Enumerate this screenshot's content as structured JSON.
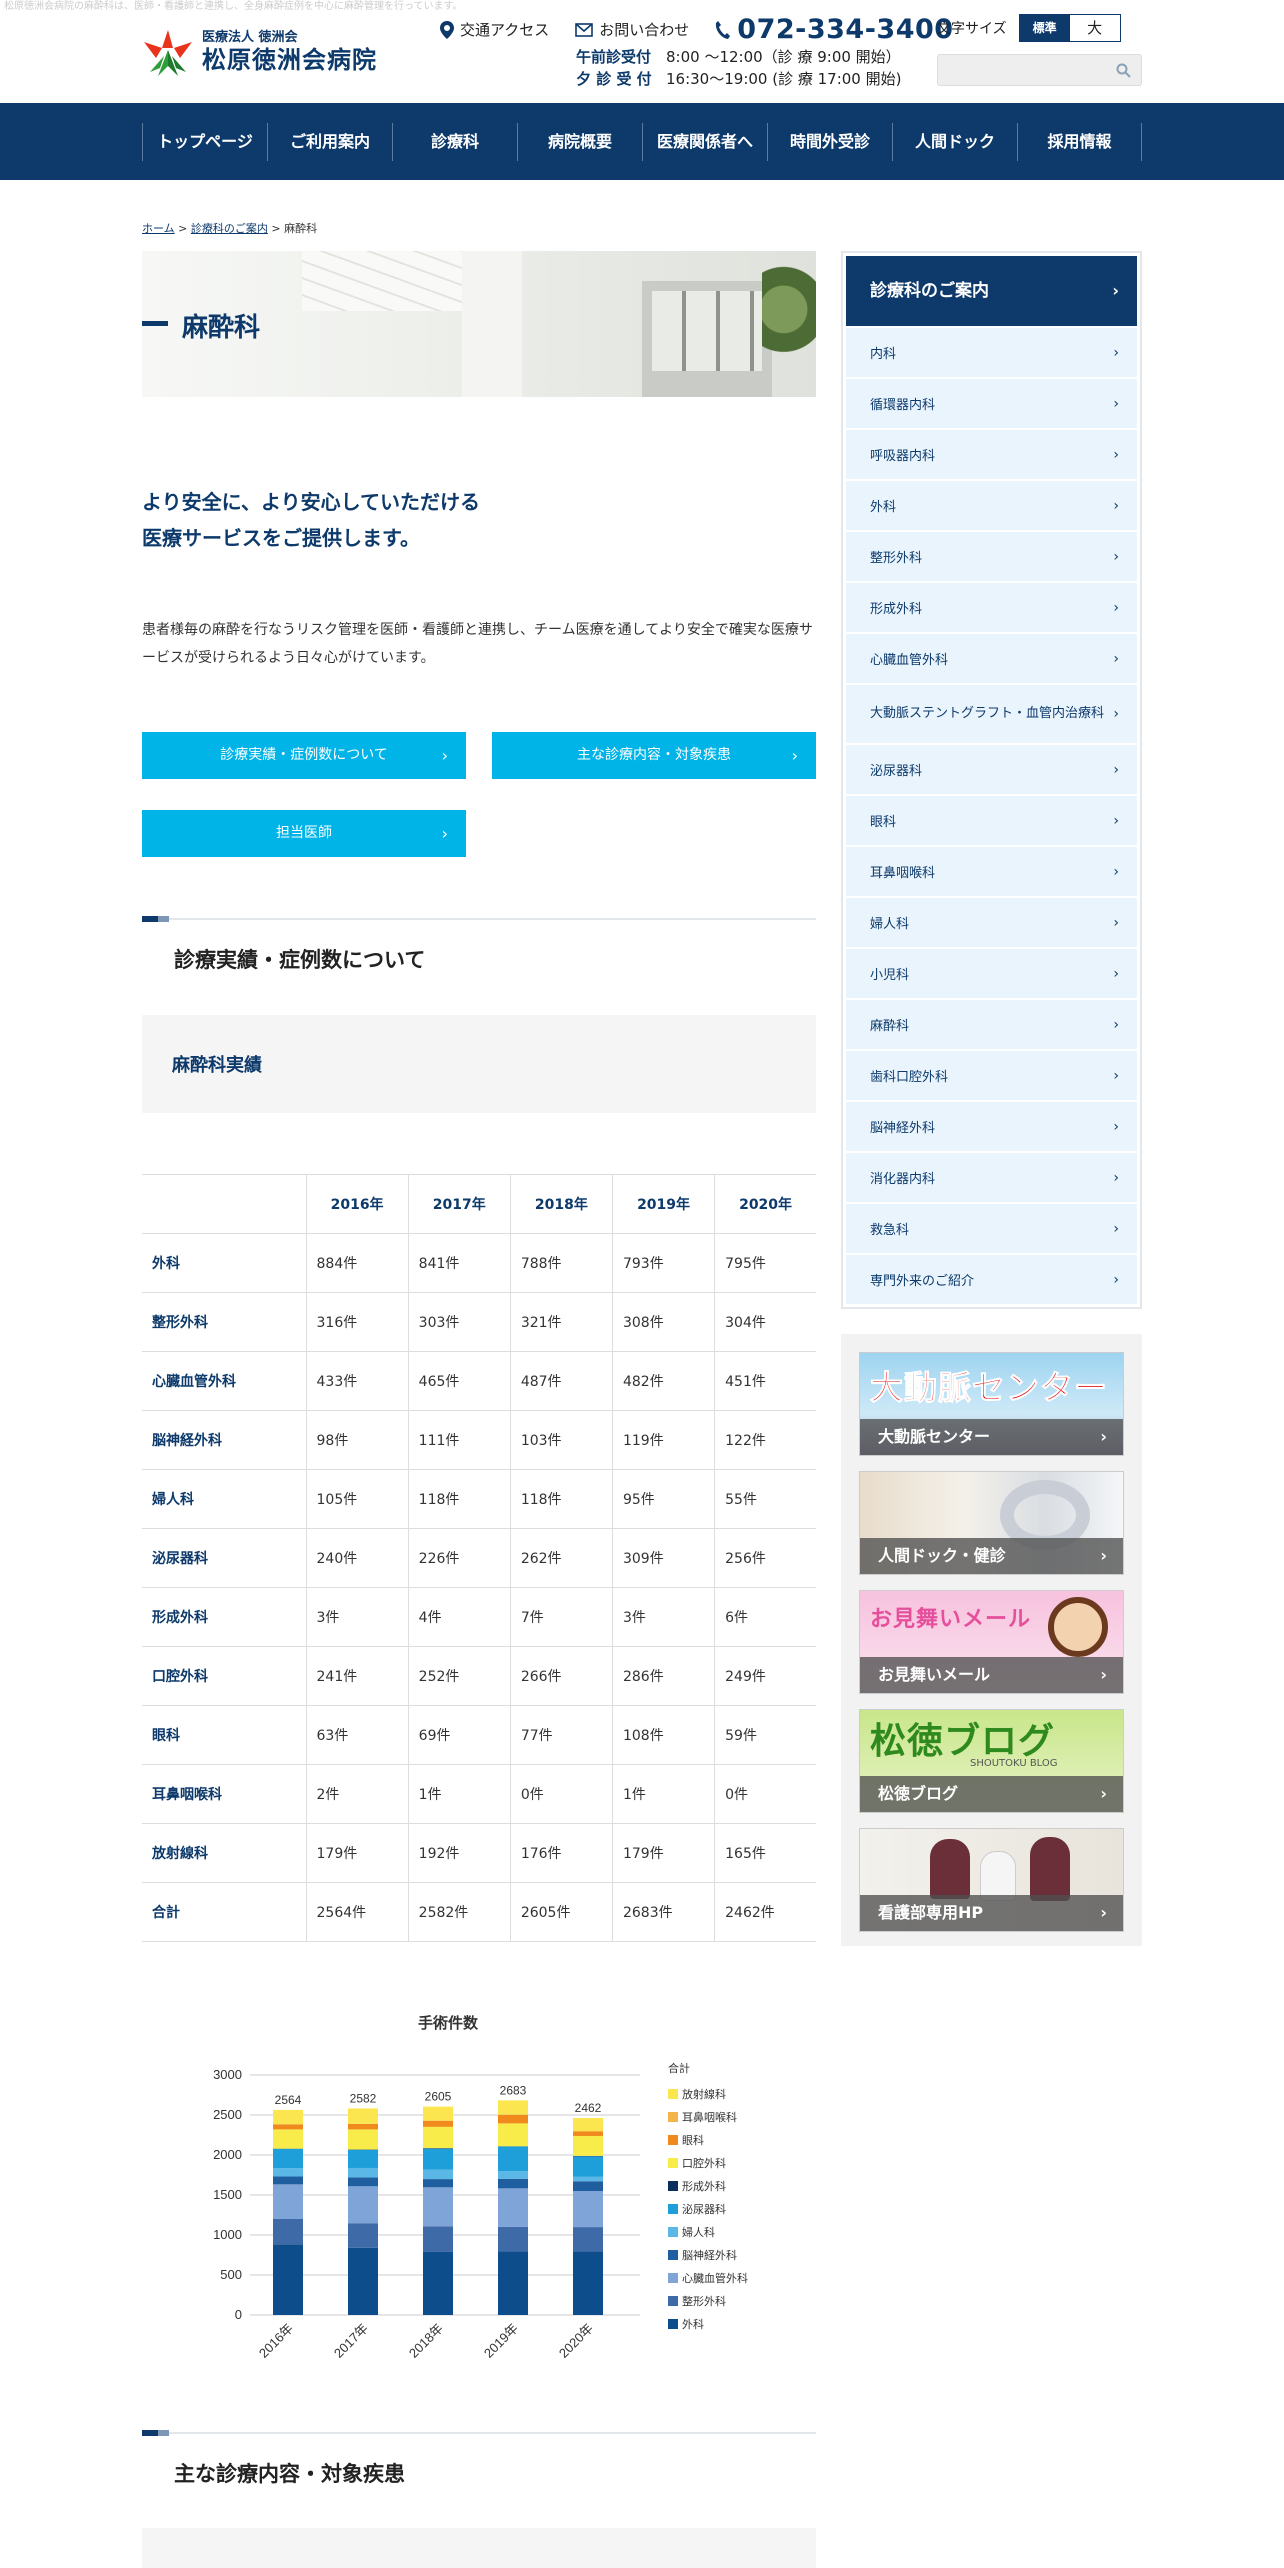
{
  "top_note": "松原徳洲会病院の麻酔科は、医師・看護師と連携し、全身麻酔症例を中心に麻酔管理を行っています。",
  "header": {
    "logo_sub": "医療法人 徳洲会",
    "logo_main": "松原徳洲会病院",
    "access": "交通アクセス",
    "contact": "お問い合わせ",
    "tel": "072-334-3400",
    "am_label": "午前診受付",
    "am_hours": "8:00 ～12:00（診 療  9:00 開始）",
    "pm_label": "夕 診 受 付",
    "pm_hours": "16:30～19:00 (診 療 17:00 開始)",
    "font_size_label": "文字サイズ",
    "font_standard": "標準",
    "font_large": "大",
    "search_placeholder": ""
  },
  "nav": [
    "トップページ",
    "ご利用案内",
    "診療科",
    "病院概要",
    "医療関係者へ",
    "時間外受診",
    "人間ドック",
    "採用情報"
  ],
  "breadcrumb": {
    "home": "ホーム",
    "sep1": ">",
    "dept": "診療科のご案内",
    "sep2": ">",
    "current": "麻酔科"
  },
  "page_title": "麻酔科",
  "lead_line1": "より安全に、より安心していただける",
  "lead_line2": "医療サービスをご提供します。",
  "description": "患者様毎の麻酔を行なうリスク管理を医師・看護師と連携し、チーム医療を通してより安全で確実な医療サービスが受けられるよう日々心がけています。",
  "buttons": [
    "診療実績・症例数について",
    "主な診療内容・対象疾患",
    "担当医師"
  ],
  "section1_title": "診療実績・症例数について",
  "subsection_title": "麻酔科実績",
  "table": {
    "years": [
      "2016年",
      "2017年",
      "2018年",
      "2019年",
      "2020年"
    ],
    "rows": [
      {
        "dept": "外科",
        "vals": [
          "884件",
          "841件",
          "788件",
          "793件",
          "795件"
        ]
      },
      {
        "dept": "整形外科",
        "vals": [
          "316件",
          "303件",
          "321件",
          "308件",
          "304件"
        ]
      },
      {
        "dept": "心臓血管外科",
        "vals": [
          "433件",
          "465件",
          "487件",
          "482件",
          "451件"
        ]
      },
      {
        "dept": "脳神経外科",
        "vals": [
          "98件",
          "111件",
          "103件",
          "119件",
          "122件"
        ]
      },
      {
        "dept": "婦人科",
        "vals": [
          "105件",
          "118件",
          "118件",
          "95件",
          "55件"
        ]
      },
      {
        "dept": "泌尿器科",
        "vals": [
          "240件",
          "226件",
          "262件",
          "309件",
          "256件"
        ]
      },
      {
        "dept": "形成外科",
        "vals": [
          "3件",
          "4件",
          "7件",
          "3件",
          "6件"
        ]
      },
      {
        "dept": "口腔外科",
        "vals": [
          "241件",
          "252件",
          "266件",
          "286件",
          "249件"
        ]
      },
      {
        "dept": "眼科",
        "vals": [
          "63件",
          "69件",
          "77件",
          "108件",
          "59件"
        ]
      },
      {
        "dept": "耳鼻咽喉科",
        "vals": [
          "2件",
          "1件",
          "0件",
          "1件",
          "0件"
        ]
      },
      {
        "dept": "放射線科",
        "vals": [
          "179件",
          "192件",
          "176件",
          "179件",
          "165件"
        ]
      },
      {
        "dept": "合計",
        "vals": [
          "2564件",
          "2582件",
          "2605件",
          "2683件",
          "2462件"
        ]
      }
    ]
  },
  "chart_data": {
    "type": "bar",
    "stacked": true,
    "title": "手術件数",
    "categories": [
      "2016年",
      "2017年",
      "2018年",
      "2019年",
      "2020年"
    ],
    "ylim": [
      0,
      3000
    ],
    "yticks": [
      0,
      500,
      1000,
      1500,
      2000,
      2500,
      3000
    ],
    "totals": [
      2564,
      2582,
      2605,
      2683,
      2462
    ],
    "legend_title": "合計",
    "series": [
      {
        "name": "外科",
        "color": "#0d4d8c",
        "values": [
          884,
          841,
          788,
          793,
          795
        ]
      },
      {
        "name": "整形外科",
        "color": "#3f6aa8",
        "values": [
          316,
          303,
          321,
          308,
          304
        ]
      },
      {
        "name": "心臓血管外科",
        "color": "#7ea4d8",
        "values": [
          433,
          465,
          487,
          482,
          451
        ]
      },
      {
        "name": "脳神経外科",
        "color": "#1f5fa0",
        "values": [
          98,
          111,
          103,
          119,
          122
        ]
      },
      {
        "name": "婦人科",
        "color": "#5ab7e6",
        "values": [
          105,
          118,
          118,
          95,
          55
        ]
      },
      {
        "name": "泌尿器科",
        "color": "#1e9fd9",
        "values": [
          240,
          226,
          262,
          309,
          256
        ]
      },
      {
        "name": "形成外科",
        "color": "#0a2f5e",
        "values": [
          3,
          4,
          7,
          3,
          6
        ]
      },
      {
        "name": "口腔外科",
        "color": "#f7ec4a",
        "values": [
          241,
          252,
          266,
          286,
          249
        ]
      },
      {
        "name": "眼科",
        "color": "#f08a1c",
        "values": [
          63,
          69,
          77,
          108,
          59
        ]
      },
      {
        "name": "耳鼻咽喉科",
        "color": "#f5b44a",
        "values": [
          2,
          1,
          0,
          1,
          0
        ]
      },
      {
        "name": "放射線科",
        "color": "#fbe650",
        "values": [
          179,
          192,
          176,
          179,
          165
        ]
      }
    ],
    "legend_placement": "right"
  },
  "section2_title": "主な診療内容・対象疾患",
  "sidebar": {
    "head": "診療科のご案内",
    "items": [
      "内科",
      "循環器内科",
      "呼吸器内科",
      "外科",
      "整形外科",
      "形成外科",
      "心臓血管外科",
      "大動脈ステントグラフト・血管内治療科",
      "泌尿器科",
      "眼科",
      "耳鼻咽喉科",
      "婦人科",
      "小児科",
      "麻酔科",
      "歯科口腔外科",
      "脳神経外科",
      "消化器内科",
      "救急科",
      "専門外来のご紹介"
    ]
  },
  "banners": [
    {
      "big": "大動脈センター",
      "label": "大動脈センター"
    },
    {
      "big": "",
      "label": "人間ドック・健診"
    },
    {
      "big": "お見舞いメール",
      "label": "お見舞いメール"
    },
    {
      "big": "松徳ブログ",
      "sub": "SHOUTOKU BLOG",
      "label": "松徳ブログ"
    },
    {
      "big": "",
      "label": "看護部専用HP"
    }
  ],
  "colors": {
    "navy": "#0d3a6b",
    "cyan": "#00b4e8",
    "side_bg": "#e9f4fd"
  }
}
